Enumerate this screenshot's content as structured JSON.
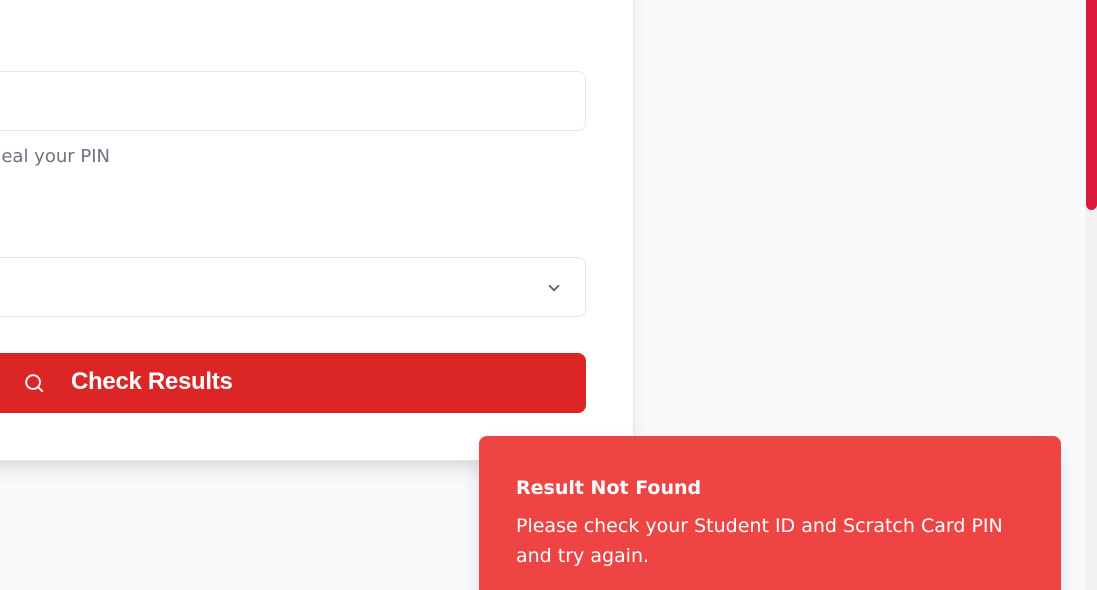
{
  "form": {
    "pin_input": {
      "value": "",
      "placeholder": ""
    },
    "pin_hint": "eal your PIN",
    "term_select": {
      "selected": ""
    },
    "check_button": {
      "label": "Check Results"
    }
  },
  "icons": {
    "select_chevron": "chevron-down-icon",
    "button_icon": "search-icon"
  },
  "toast": {
    "title": "Result Not Found",
    "message": "Please check your Student ID and Scratch Card PIN and try again."
  },
  "colors": {
    "primary_red": "#dc2626",
    "toast_red": "#ef4444",
    "scrollbar_thumb": "#dc1a3e"
  }
}
